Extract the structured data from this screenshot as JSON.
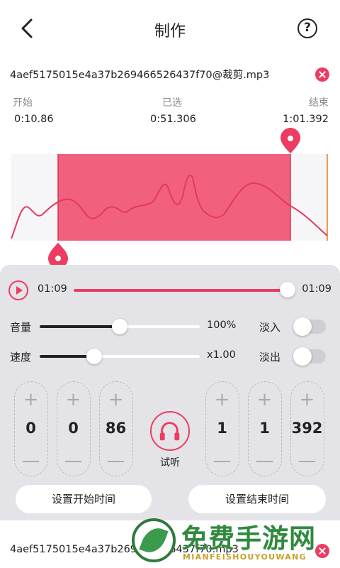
{
  "header": {
    "title": "制作"
  },
  "file": {
    "name": "4aef5175015e4a37b269466526437f70@裁剪.mp3"
  },
  "times": {
    "start_label": "开始",
    "start_value": "0:10.86",
    "selected_label": "已选",
    "selected_value": "0:51.306",
    "end_label": "结束",
    "end_value": "1:01.392"
  },
  "player": {
    "current": "01:09",
    "total": "01:09",
    "progress": 1.0
  },
  "volume": {
    "label": "音量",
    "value": "100%",
    "level": 0.5,
    "fade_label": "淡入",
    "fade_on": false
  },
  "speed": {
    "label": "速度",
    "value": "x1.00",
    "level": 0.34,
    "fade_label": "淡出",
    "fade_on": false
  },
  "start_stepper": {
    "minutes": "0",
    "seconds": "0",
    "millis": "86"
  },
  "end_stepper": {
    "minutes": "1",
    "seconds": "1",
    "millis": "392"
  },
  "stepper_symbols": {
    "plus": "+",
    "minus": "—"
  },
  "listen": {
    "label": "试听"
  },
  "buttons": {
    "set_start": "设置开始时间",
    "set_end": "设置结束时间"
  },
  "file2": {
    "name": "4aef5175015e4a37b269466526437f70.mp3"
  },
  "watermark": {
    "text": "免费手游网",
    "sub": "MIANFEISHOUYOUWANG"
  },
  "colors": {
    "accent": "#ee3b61",
    "selection": "#f2607f",
    "panel": "#e4e4e8"
  }
}
